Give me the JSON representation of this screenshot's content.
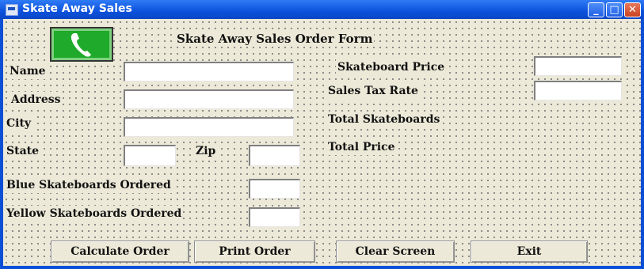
{
  "window": {
    "title": "Skate Away Sales",
    "controls": {
      "minimize": "_",
      "maximize": "□",
      "close": "✕"
    }
  },
  "form": {
    "header": "Skate Away Sales Order Form",
    "logo_icon": "phone-icon",
    "labels": {
      "name": "Name",
      "address": "Address",
      "city": "City",
      "state": "State",
      "zip": "Zip",
      "blue": "Blue Skateboards Ordered",
      "yellow": "Yellow Skateboards Ordered",
      "skateboard_price": "Skateboard Price",
      "sales_tax_rate": "Sales Tax Rate",
      "total_skateboards": "Total Skateboards",
      "total_price": "Total Price"
    },
    "values": {
      "name": "",
      "address": "",
      "city": "",
      "state": "",
      "zip": "",
      "blue": "",
      "yellow": "",
      "skateboard_price": "",
      "sales_tax_rate": ""
    }
  },
  "buttons": {
    "calculate": "Calculate Order",
    "print": "Print Order",
    "clear": "Clear Screen",
    "exit": "Exit"
  },
  "colors": {
    "title_bar": "#0c52dc",
    "client_bg": "#ece9d8",
    "logo_bg": "#1faa2b"
  }
}
